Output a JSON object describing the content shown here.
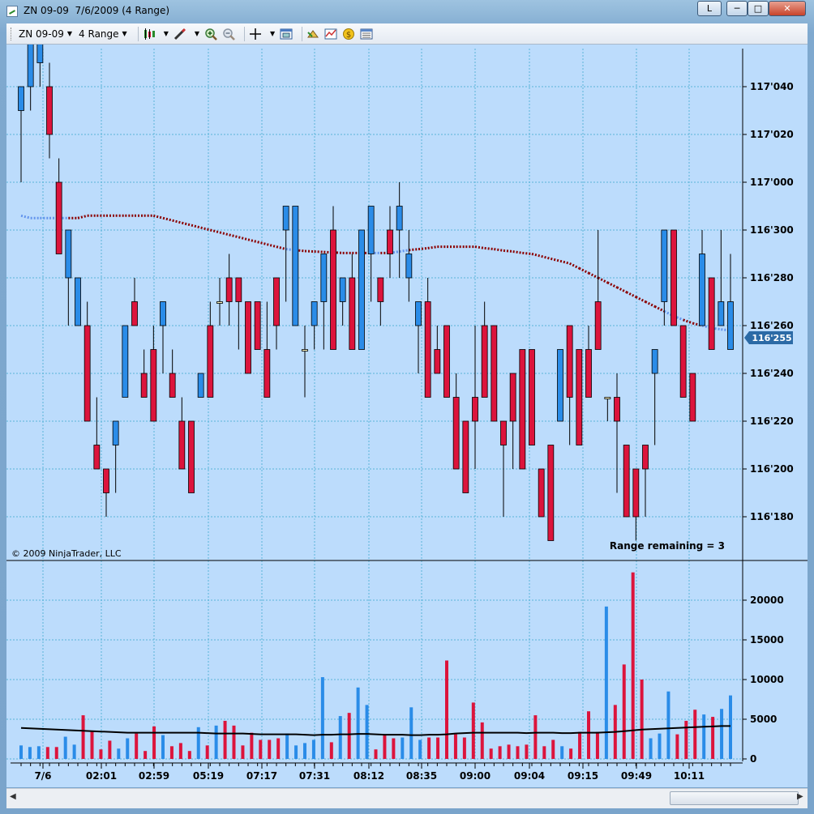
{
  "window": {
    "title": "ZN 09-09  7/6/2009 (4 Range)",
    "buttons": {
      "layout": "L",
      "minimize": "─",
      "maximize": "□",
      "close": "✕"
    }
  },
  "toolbar": {
    "instrument": "ZN 09-09",
    "period": "4 Range",
    "icons": [
      "candlestick-icon",
      "pencil-icon",
      "zoom-in-icon",
      "zoom-out-icon",
      "crosshair-icon",
      "properties-icon",
      "strategy-icon",
      "indicator-icon",
      "coin-icon",
      "data-box-icon"
    ]
  },
  "chart": {
    "copyright": "© 2009 NinjaTrader, LLC",
    "range_remaining": "Range remaining = 3",
    "current_price_label": "116'255",
    "colors": {
      "background": "#bcdcfc",
      "up": "#2a8ce8",
      "down": "#dc143c",
      "neutral": "#fff8c0",
      "ma_above": "#8b0000",
      "ma_below": "#6495ed",
      "volume_avg": "#000000"
    }
  },
  "chart_data": [
    {
      "type": "candlestick",
      "title": "ZN 09-09 4 Range",
      "categories": [
        "7/6",
        "02:01",
        "02:59",
        "05:19",
        "07:17",
        "07:31",
        "08:12",
        "08:35",
        "09:00",
        "09:04",
        "09:15",
        "09:49",
        "10:11"
      ],
      "y_tick_labels": [
        "116'180",
        "116'200",
        "116'220",
        "116'240",
        "116'260",
        "116'280",
        "116'300",
        "117'000",
        "117'020",
        "117'040"
      ],
      "ylim_ticks": [
        -1.5,
        10.5
      ],
      "bars": [
        {
          "o": 5.5,
          "h": 6,
          "l": 4.0,
          "c": 6
        },
        {
          "o": 6,
          "h": 8,
          "l": 5.5,
          "c": 7.5
        },
        {
          "o": 6.5,
          "h": 7.5,
          "l": 6,
          "c": 8.0
        },
        {
          "o": 6.0,
          "h": 6.5,
          "l": 4.5,
          "c": 5
        },
        {
          "o": 4.0,
          "h": 4.5,
          "l": 3.5,
          "c": 2.5
        },
        {
          "o": 2.0,
          "h": 3,
          "l": 1,
          "c": 3.0
        },
        {
          "o": 1,
          "h": 1.5,
          "l": 1,
          "c": 2
        },
        {
          "o": 1.0,
          "h": 1.5,
          "l": -1,
          "c": -1.0
        },
        {
          "o": -1.5,
          "h": -0.5,
          "l": -2.0,
          "c": -2.0
        },
        {
          "o": -2.0,
          "h": -2,
          "l": -3.0,
          "c": -2.5
        },
        {
          "o": -1.5,
          "h": -1,
          "l": -2.5,
          "c": -1.0
        },
        {
          "o": -0.5,
          "h": 1,
          "l": 0,
          "c": 1
        },
        {
          "o": 1.5,
          "h": 2,
          "l": 1,
          "c": 1
        },
        {
          "o": 0,
          "h": 0.5,
          "l": -0.5,
          "c": -0.5
        },
        {
          "o": 0.5,
          "h": 1,
          "l": -1,
          "c": -1.0
        },
        {
          "o": 1.0,
          "h": 1.5,
          "l": 0,
          "c": 1.5
        },
        {
          "o": 0,
          "h": 0.5,
          "l": -0.5,
          "c": -0.5
        },
        {
          "o": -1.0,
          "h": -0.5,
          "l": -2.0,
          "c": -2.0
        },
        {
          "o": -1.0,
          "h": -1,
          "l": -2.5,
          "c": -2.5
        },
        {
          "o": -0.5,
          "h": 0,
          "l": -0.5,
          "c": 0
        },
        {
          "o": 1,
          "h": 1.5,
          "l": 0.5,
          "c": -0.5
        },
        {
          "o": 1.5,
          "h": 2,
          "l": 1,
          "c": 1.5
        },
        {
          "o": 2,
          "h": 2.5,
          "l": 1,
          "c": 1.5
        },
        {
          "o": 2.0,
          "h": 1.5,
          "l": 0.5,
          "c": 1.5
        },
        {
          "o": 1.5,
          "h": 1.5,
          "l": 0,
          "c": 0
        },
        {
          "o": 1.5,
          "h": 1.5,
          "l": 0.5,
          "c": 0.5
        },
        {
          "o": 0.5,
          "h": 1.5,
          "l": 0,
          "c": -0.5
        },
        {
          "o": 2,
          "h": 2,
          "l": 0.5,
          "c": 1
        },
        {
          "o": 3,
          "h": 3.5,
          "l": 1.5,
          "c": 3.5
        },
        {
          "o": 1,
          "h": 2,
          "l": 1,
          "c": 3.5
        },
        {
          "o": 0.5,
          "h": 1,
          "l": -0.5,
          "c": 0.5
        },
        {
          "o": 1,
          "h": 1,
          "l": 0.5,
          "c": 1.5
        },
        {
          "o": 1.5,
          "h": 1.5,
          "l": 0.5,
          "c": 2.5
        },
        {
          "o": 3.0,
          "h": 3.5,
          "l": 2,
          "c": 0.5
        },
        {
          "o": 1.5,
          "h": 2,
          "l": 1,
          "c": 2
        },
        {
          "o": 2,
          "h": 2.5,
          "l": 1,
          "c": 0.5
        },
        {
          "o": 0.5,
          "h": 2.5,
          "l": 1,
          "c": 3
        },
        {
          "o": 2.5,
          "h": 3.5,
          "l": 1.5,
          "c": 3.5
        },
        {
          "o": 2,
          "h": 2,
          "l": 1,
          "c": 1.5
        },
        {
          "o": 3.0,
          "h": 3.5,
          "l": 2,
          "c": 2.5
        },
        {
          "o": 3,
          "h": 4,
          "l": 2,
          "c": 3.5
        },
        {
          "o": 2,
          "h": 3,
          "l": 1.5,
          "c": 2.5
        },
        {
          "o": 1,
          "h": 1.5,
          "l": 0,
          "c": 1.5
        },
        {
          "o": 1.5,
          "h": 2,
          "l": 0,
          "c": -0.5
        },
        {
          "o": 0.5,
          "h": 1,
          "l": 0,
          "c": 0
        },
        {
          "o": 1,
          "h": 1,
          "l": 0,
          "c": -0.5
        },
        {
          "o": -0.5,
          "h": 0,
          "l": -2.0,
          "c": -2.0
        },
        {
          "o": -1.0,
          "h": -1,
          "l": -2.5,
          "c": -2.5
        },
        {
          "o": -0.5,
          "h": 1,
          "l": -2.0,
          "c": -1.0
        },
        {
          "o": 1,
          "h": 1.5,
          "l": 0.5,
          "c": -0.5
        },
        {
          "o": 1,
          "h": 1,
          "l": -1,
          "c": -1.0
        },
        {
          "o": -1.0,
          "h": -1,
          "l": -3.0,
          "c": -1.5
        },
        {
          "o": 0,
          "h": 0,
          "l": -2.0,
          "c": -1.0
        },
        {
          "o": 0.5,
          "h": 0.5,
          "l": -2.0,
          "c": -2.0
        },
        {
          "o": 0.5,
          "h": 0.5,
          "l": -1.5,
          "c": -1.5
        },
        {
          "o": -2.0,
          "h": -2,
          "l": -3.0,
          "c": -3.0
        },
        {
          "o": -1.5,
          "h": -1.5,
          "l": -3.5,
          "c": -3.5
        },
        {
          "o": -1.0,
          "h": 0.5,
          "l": -1.0,
          "c": 0.5
        },
        {
          "o": 1,
          "h": 1,
          "l": -1.5,
          "c": -0.5
        },
        {
          "o": 0.5,
          "h": 0.5,
          "l": -1.5,
          "c": -1.5
        },
        {
          "o": 0.5,
          "h": 1,
          "l": -0.5,
          "c": -0.5
        },
        {
          "o": 1.5,
          "h": 3,
          "l": 0.5,
          "c": 0.5
        },
        {
          "o": -0.5,
          "h": -0.5,
          "l": -1.0,
          "c": -0.5
        },
        {
          "o": -0.5,
          "h": 0,
          "l": -2.5,
          "c": -1.0
        },
        {
          "o": -1.5,
          "h": -2.5,
          "l": -2.5,
          "c": -3.0
        },
        {
          "o": -2.0,
          "h": -2.0,
          "l": -3.5,
          "c": -3.0
        },
        {
          "o": -1.5,
          "h": -1.5,
          "l": -3.0,
          "c": -2.0
        },
        {
          "o": 0,
          "h": 0.5,
          "l": -1.5,
          "c": 0.5
        },
        {
          "o": 1.5,
          "h": 3,
          "l": 1,
          "c": 3
        },
        {
          "o": 3,
          "h": 3,
          "l": 1,
          "c": 1
        },
        {
          "o": 1,
          "h": 1,
          "l": -0.5,
          "c": -0.5
        },
        {
          "o": 0,
          "h": 0,
          "l": -1.0,
          "c": -1.0
        },
        {
          "o": 1,
          "h": 3,
          "l": 1,
          "c": 2.5
        },
        {
          "o": 2,
          "h": 2,
          "l": 0.5,
          "c": 0.5
        },
        {
          "o": 1,
          "h": 3,
          "l": 1,
          "c": 1.5
        },
        {
          "o": 0.5,
          "h": 2.5,
          "l": 1,
          "c": 1.5
        }
      ],
      "moving_average": [
        3.3,
        3.25,
        3.25,
        3.25,
        3.25,
        3.25,
        3.25,
        3.3,
        3.3,
        3.3,
        3.3,
        3.3,
        3.3,
        3.3,
        3.3,
        3.25,
        3.2,
        3.15,
        3.1,
        3.05,
        3.0,
        2.95,
        2.9,
        2.85,
        2.8,
        2.75,
        2.7,
        2.65,
        2.6,
        2.58,
        2.56,
        2.55,
        2.54,
        2.53,
        2.52,
        2.52,
        2.52,
        2.52,
        2.52,
        2.52,
        2.55,
        2.58,
        2.6,
        2.62,
        2.65,
        2.65,
        2.65,
        2.65,
        2.65,
        2.62,
        2.6,
        2.57,
        2.55,
        2.52,
        2.5,
        2.45,
        2.4,
        2.35,
        2.3,
        2.2,
        2.1,
        2.0,
        1.9,
        1.8,
        1.7,
        1.6,
        1.5,
        1.4,
        1.3,
        1.2,
        1.12,
        1.05,
        1.0,
        0.95,
        0.92,
        0.9
      ]
    },
    {
      "type": "bar",
      "title": "Volume",
      "y_tick_labels": [
        "0",
        "5000",
        "10000",
        "15000",
        "20000"
      ],
      "ylim": [
        0,
        24000
      ],
      "values": [
        1700,
        1500,
        1600,
        1500,
        1500,
        2800,
        1800,
        5500,
        3500,
        1200,
        2300,
        1300,
        2600,
        3200,
        1000,
        4100,
        3000,
        1600,
        2000,
        1000,
        4000,
        1700,
        4200,
        4800,
        4200,
        1700,
        3300,
        2400,
        2400,
        2600,
        3200,
        1700,
        2000,
        2400,
        10300,
        2100,
        5400,
        5800,
        9000,
        6800,
        1200,
        3100,
        2600,
        2700,
        6500,
        2400,
        2700,
        2700,
        12400,
        3100,
        2700,
        7100,
        4600,
        1300,
        1600,
        1800,
        1600,
        1800,
        5500,
        1600,
        2400,
        1600,
        1300,
        3400,
        6000,
        3400,
        19200,
        6800,
        11900,
        23500,
        10000,
        2600,
        3200,
        8500,
        3100,
        4800,
        6200,
        5600,
        5300,
        6300,
        8000
      ],
      "average": [
        3900,
        3850,
        3800,
        3750,
        3700,
        3650,
        3600,
        3550,
        3500,
        3450,
        3400,
        3350,
        3300,
        3300,
        3300,
        3300,
        3300,
        3300,
        3300,
        3300,
        3300,
        3250,
        3200,
        3200,
        3200,
        3200,
        3150,
        3100,
        3100,
        3100,
        3100,
        3100,
        3050,
        3000,
        3050,
        3050,
        3100,
        3100,
        3150,
        3150,
        3100,
        3050,
        3050,
        3050,
        3000,
        3000,
        3050,
        3050,
        3100,
        3200,
        3250,
        3300,
        3300,
        3300,
        3300,
        3300,
        3300,
        3250,
        3300,
        3300,
        3300,
        3250,
        3250,
        3300,
        3300,
        3300,
        3350,
        3400,
        3500,
        3600,
        3700,
        3750,
        3800,
        3850,
        3900,
        3950,
        4000,
        4050,
        4100,
        4150,
        4150
      ]
    }
  ]
}
